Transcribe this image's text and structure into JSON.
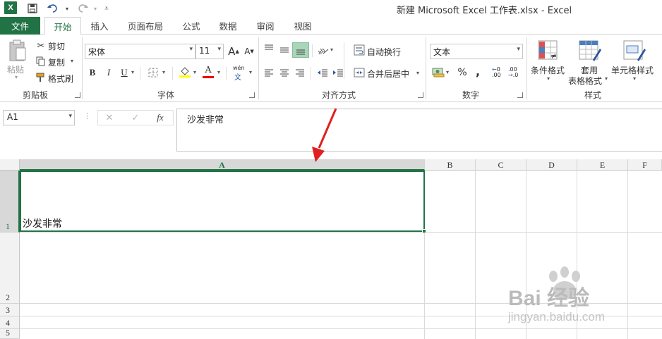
{
  "window": {
    "title": "新建 Microsoft Excel 工作表.xlsx - Excel",
    "app_icon": "excel-icon",
    "app_icon_letter": "X"
  },
  "quick_access": {
    "save_icon": "save-icon",
    "undo_icon": "undo-icon",
    "redo_icon": "redo-icon",
    "customize_icon": "customize-qat-icon"
  },
  "tabs": [
    {
      "label": "文件"
    },
    {
      "label": "开始"
    },
    {
      "label": "插入"
    },
    {
      "label": "页面布局"
    },
    {
      "label": "公式"
    },
    {
      "label": "数据"
    },
    {
      "label": "审阅"
    },
    {
      "label": "视图"
    }
  ],
  "ribbon": {
    "clipboard": {
      "group_label": "剪贴板",
      "paste": "粘贴",
      "cut": "剪切",
      "copy": "复制",
      "format_painter": "格式刷"
    },
    "font": {
      "group_label": "字体",
      "font_name": "宋体",
      "font_size": "11",
      "grow": "A",
      "shrink": "A",
      "bold": "B",
      "italic": "I",
      "underline": "U",
      "font_color_letter": "A",
      "phonetic": "wén"
    },
    "alignment": {
      "group_label": "对齐方式",
      "wrap_text": "自动换行",
      "merge_center": "合并后居中"
    },
    "number": {
      "group_label": "数字",
      "format": "文本",
      "percent": "%",
      "comma": ","
    },
    "styles": {
      "group_label": "样式",
      "conditional_format": "条件格式",
      "format_as_table_line1": "套用",
      "format_as_table_line2": "表格格式",
      "cell_styles": "单元格样式"
    }
  },
  "formula_bar": {
    "name_box": "A1",
    "cancel": "✕",
    "enter": "✓",
    "fx": "fx",
    "content": "沙发非常"
  },
  "grid": {
    "columns": [
      "A",
      "B",
      "C",
      "D",
      "E",
      "F"
    ],
    "rows": [
      "1",
      "2",
      "3",
      "4",
      "5"
    ],
    "cell_a1": "沙发非常",
    "selected_cell": "A1"
  },
  "watermark": {
    "brand": "Bai 经验",
    "url": "jingyan.baidu.com"
  },
  "colors": {
    "accent": "#217346",
    "arrow": "#e02020"
  }
}
